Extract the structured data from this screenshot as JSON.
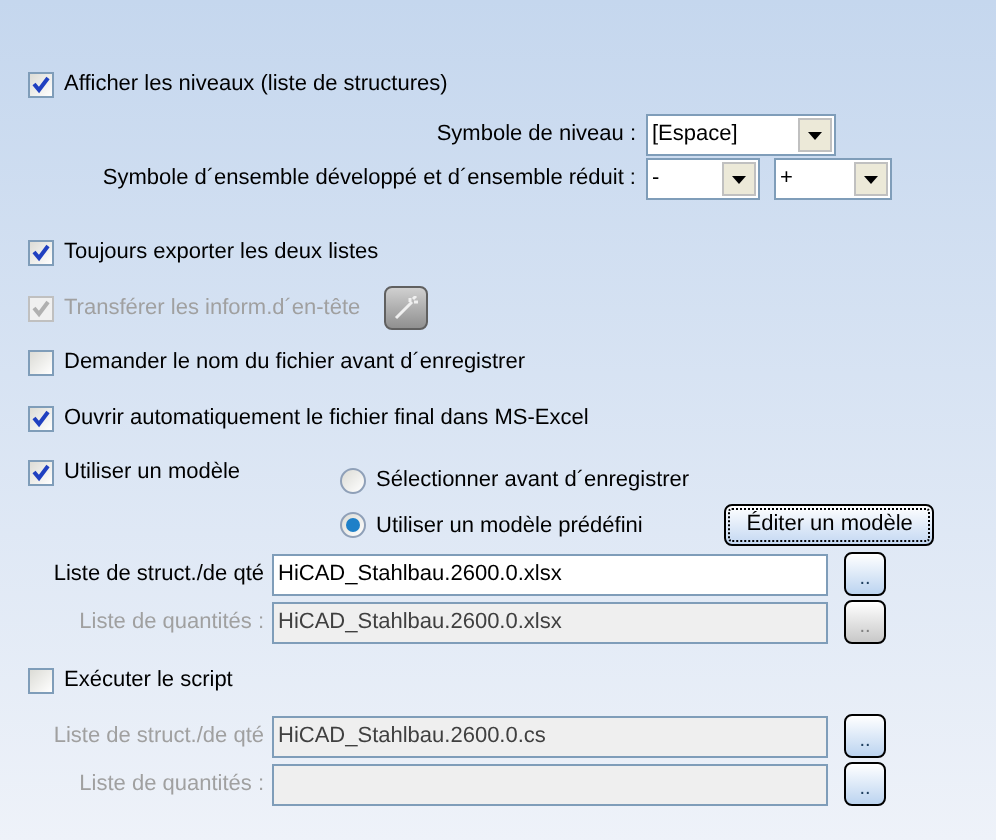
{
  "show_levels": {
    "label": "Afficher les niveaux (liste de structures)",
    "checked": true
  },
  "level_symbol": {
    "label": "Symbole de niveau :",
    "value": "[Espace]"
  },
  "assembly_symbols": {
    "label": "Symbole d´ensemble développé et d´ensemble réduit :",
    "expanded_value": "-",
    "collapsed_value": "+"
  },
  "export_both": {
    "label": "Toujours exporter les deux listes",
    "checked": true
  },
  "transfer_header": {
    "label": "Transférer les inform.d´en-tête",
    "checked": true,
    "disabled": true
  },
  "ask_filename": {
    "label": "Demander le nom du fichier avant d´enregistrer",
    "checked": false
  },
  "open_excel": {
    "label": "Ouvrir automatiquement le fichier final dans MS-Excel",
    "checked": true
  },
  "use_template": {
    "label": "Utiliser un modèle",
    "checked": true,
    "options": [
      {
        "label": "Sélectionner avant d´enregistrer",
        "selected": false
      },
      {
        "label": "Utiliser un modèle prédéfini",
        "selected": true
      }
    ],
    "edit_button": "Éditer un modèle",
    "fields": [
      {
        "label": "Liste de struct./de qté",
        "value": "HiCAD_Stahlbau.2600.0.xlsx",
        "disabled": false,
        "button": "..",
        "button_disabled": false
      },
      {
        "label": "Liste de quantités :",
        "value": "HiCAD_Stahlbau.2600.0.xlsx",
        "disabled": true,
        "button": "..",
        "button_disabled": true
      }
    ]
  },
  "run_script": {
    "label": "Exécuter le script",
    "checked": false,
    "fields": [
      {
        "label": "Liste de struct./de qté",
        "value": "HiCAD_Stahlbau.2600.0.cs",
        "disabled": true,
        "button": "..",
        "button_disabled": false
      },
      {
        "label": "Liste de quantités :",
        "disabled": true,
        "button": "..",
        "button_disabled": false
      }
    ]
  }
}
